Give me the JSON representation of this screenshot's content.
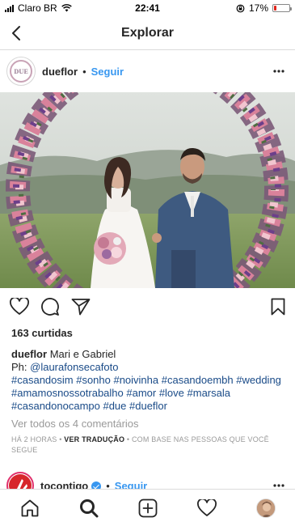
{
  "status_bar": {
    "carrier": "Claro BR",
    "time": "22:41",
    "battery_percent": "17%",
    "battery_level": 0.17
  },
  "header": {
    "title": "Explorar"
  },
  "post": {
    "username": "dueflor",
    "separator": "•",
    "follow_label": "Seguir",
    "avatar_text": "DUE",
    "likes": "163 curtidas",
    "caption": {
      "username": "dueflor",
      "text": "Mari e Gabriel",
      "ph_prefix": "Ph: ",
      "photographer": "@laurafonsecafoto",
      "hashtags": "#casandosim #sonho #noivinha #casandoembh #wedding #amamosnossotrabalho #amor #love #marsala #casandonocampo #due #dueflor"
    },
    "view_comments": "Ver todos os 4 comentários",
    "time_ago": "HÁ 2 HORAS",
    "meta_sep": "•",
    "translate": "VER TRADUÇÃO",
    "based_on": "COM BASE NAS PESSOAS QUE VOCÊ SEGUE"
  },
  "next_post": {
    "username": "tocontigo",
    "separator": "•",
    "follow_label": "Seguir"
  },
  "icons": [
    "back-icon",
    "more-icon",
    "heart-icon",
    "comment-icon",
    "share-icon",
    "bookmark-icon",
    "home-icon",
    "search-icon",
    "add-icon",
    "activity-icon",
    "profile-avatar"
  ],
  "colors": {
    "link": "#3897f0",
    "hashtag": "#1a4b88",
    "text": "#262626",
    "muted": "#999999",
    "battery_low": "#e0241b"
  }
}
